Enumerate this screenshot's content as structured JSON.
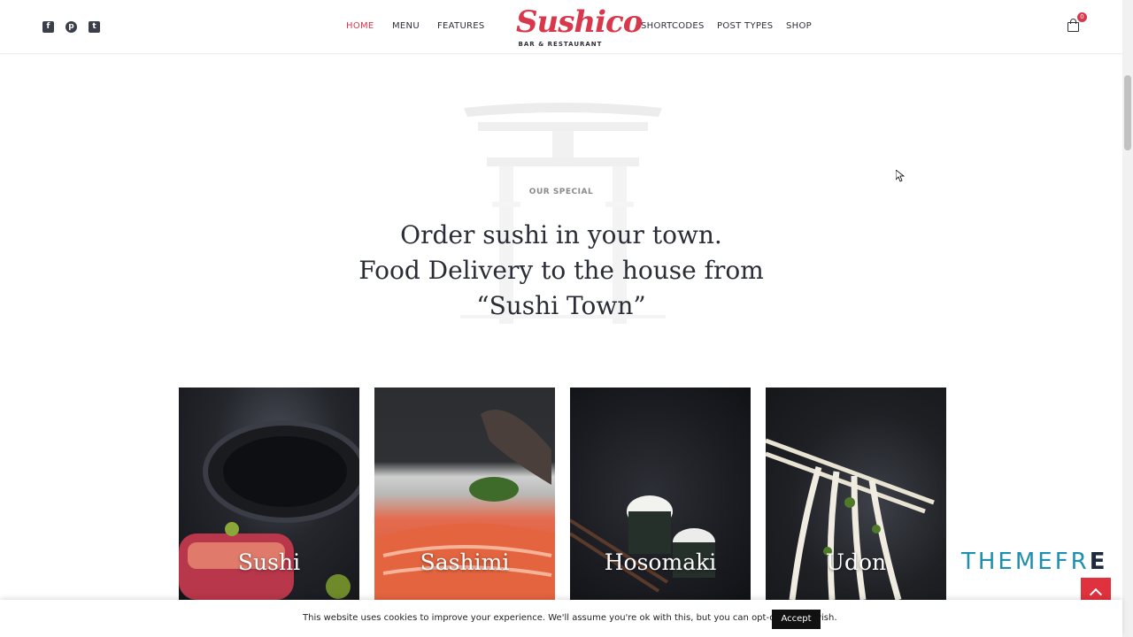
{
  "header": {
    "social": [
      {
        "name": "facebook-icon",
        "glyph": "f"
      },
      {
        "name": "pinterest-icon",
        "glyph": "p"
      },
      {
        "name": "twitter-icon",
        "glyph": "t"
      }
    ],
    "nav_left": [
      "HOME",
      "MENU",
      "FEATURES"
    ],
    "nav_right": [
      "SHORTCODES",
      "POST TYPES",
      "SHOP"
    ],
    "active_nav": "HOME",
    "logo": {
      "script": "Sushico",
      "sub": "BAR & RESTAURANT"
    },
    "cart_count": "0"
  },
  "hero": {
    "eyebrow": "OUR SPECIAL",
    "headline_lines": [
      "Order sushi in your town.",
      "Food Delivery to the house from",
      "“Sushi Town”"
    ]
  },
  "cards": [
    "Sushi",
    "Sashimi",
    "Hosomaki",
    "Udon"
  ],
  "watermark": {
    "text": "THEMEFR",
    "tail": "E"
  },
  "cookie": {
    "text": "This website uses cookies to improve your experience. We'll assume you're ok with this, but you can opt-out if you wish.",
    "accept_label": "Accept"
  },
  "colors": {
    "accent": "#d9374b",
    "dark": "#2a2c36",
    "watermark": "#1f8fae"
  }
}
